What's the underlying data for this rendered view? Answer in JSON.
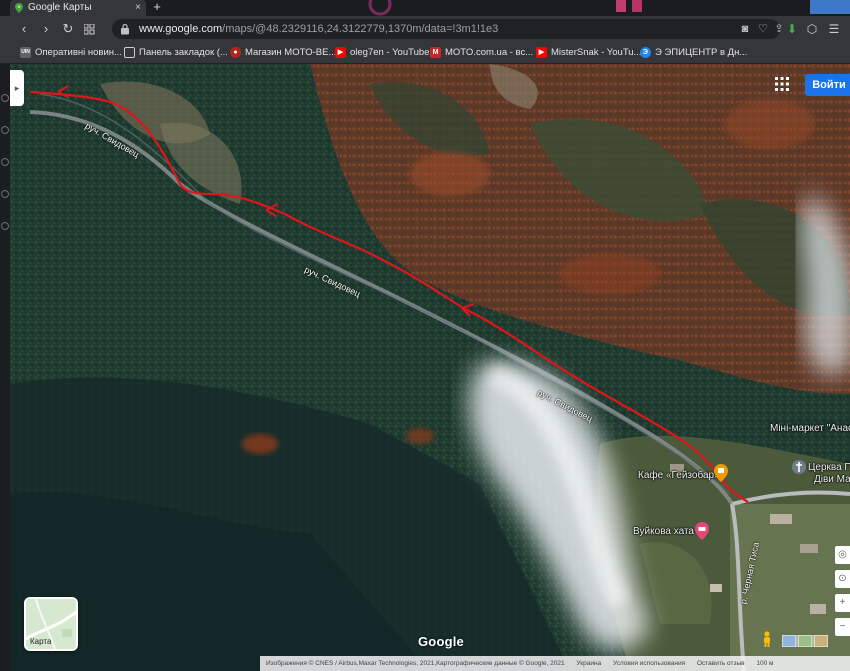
{
  "browser": {
    "tab_title": "Google Карты",
    "tab_close": "×",
    "new_tab": "+",
    "url_host": "www.google.com",
    "url_path": "/maps/@48.2329116,24.3122779,1370m/data=!3m1!1e3"
  },
  "bookmarks": [
    {
      "label": "Оперативні новин...",
      "icon": "uin-icon",
      "color": "#5f6368",
      "glyph": "UIN"
    },
    {
      "label": "Панель закладок (...",
      "icon": "folder-icon",
      "color": "#35363a",
      "glyph": "▭"
    },
    {
      "label": "Магазин MOTO-BE...",
      "icon": "moto-be-icon",
      "color": "#b3261e",
      "glyph": "●"
    },
    {
      "label": "oleg7en - YouTube",
      "icon": "youtube-icon",
      "color": "#ff0000",
      "glyph": "▶"
    },
    {
      "label": "MOTO.com.ua - вс...",
      "icon": "moto-icon",
      "color": "#c62828",
      "glyph": "M"
    },
    {
      "label": "MisterSnak - YouTu...",
      "icon": "youtube-icon",
      "color": "#ff0000",
      "glyph": "▶"
    },
    {
      "label": "Э ЭПИЦЕНТР в Дн...",
      "icon": "epicentr-icon",
      "color": "#1e88e5",
      "glyph": "Э"
    }
  ],
  "map": {
    "signin": "Войти",
    "layer_label": "Карта",
    "google": "Google",
    "stream_name": "руч. Свидовец",
    "river_name": "р. Черная Тиса",
    "pois": {
      "cafe": "Кафе «Гейзобар»",
      "hut": "Вуйкова хата",
      "market": "Міні-маркет \"Анаст",
      "church_line1": "Церква Пре",
      "church_line2": "Діви Мар"
    },
    "footer": {
      "attribution": "Изображения © CNES / Airbus,Maxar Technologies, 2021,Картографические данные © Google, 2021",
      "country": "Украина",
      "terms": "Условия использования",
      "feedback": "Оставить отзыв",
      "scale": "100 м"
    }
  }
}
